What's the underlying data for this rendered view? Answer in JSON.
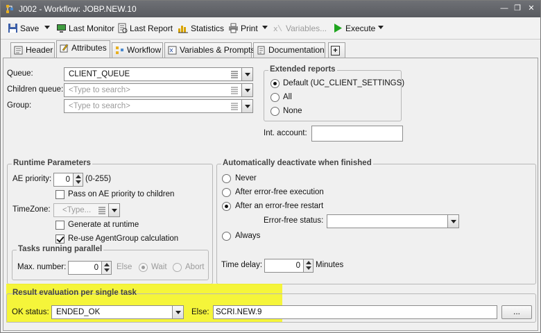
{
  "window": {
    "title": "J002 - Workflow: JOBP.NEW.10",
    "min": "—",
    "max": "❐",
    "close": "✕"
  },
  "toolbar": {
    "save": "Save",
    "last_monitor": "Last Monitor",
    "last_report": "Last Report",
    "statistics": "Statistics",
    "print": "Print",
    "variables": "Variables...",
    "execute": "Execute"
  },
  "tabs": [
    "Header",
    "Attributes",
    "Workflow",
    "Variables & Prompts",
    "Documentation",
    "+"
  ],
  "queue": {
    "queue_label": "Queue:",
    "queue_value": "CLIENT_QUEUE",
    "children_label": "Children queue:",
    "children_placeholder": "<Type to search>",
    "group_label": "Group:",
    "group_placeholder": "<Type to search>"
  },
  "extended_reports": {
    "title": "Extended reports",
    "options": [
      "Default (UC_CLIENT_SETTINGS)",
      "All",
      "None"
    ],
    "selected": 0,
    "int_account_label": "Int. account:",
    "int_account_value": ""
  },
  "runtime": {
    "title": "Runtime Parameters",
    "ae_priority_label": "AE priority:",
    "ae_priority_value": "0",
    "ae_priority_range": "(0-255)",
    "pass_priority": "Pass on AE priority to children",
    "pass_priority_checked": false,
    "timezone_label": "TimeZone:",
    "timezone_placeholder": "<Type...",
    "generate_runtime": "Generate at runtime",
    "generate_runtime_checked": false,
    "reuse_agentgroup": "Re-use AgentGroup calculation",
    "reuse_agentgroup_checked": true
  },
  "parallel": {
    "title": "Tasks running parallel",
    "max_label": "Max. number:",
    "max_value": "0",
    "else_label": "Else",
    "wait": "Wait",
    "abort": "Abort",
    "selected": "Wait"
  },
  "deactivate": {
    "title": "Automatically deactivate when finished",
    "options": [
      "Never",
      "After error-free execution",
      "After an error-free restart",
      "Always"
    ],
    "selected": 2,
    "error_free_status_label": "Error-free status:",
    "error_free_status_value": "",
    "time_delay_label": "Time delay:",
    "time_delay_value": "0",
    "minutes": "Minutes"
  },
  "result": {
    "title": "Result evaluation per single task",
    "ok_status_label": "OK status:",
    "ok_status_value": "ENDED_OK",
    "else_label": "Else:",
    "else_value": "SCRI.NEW.9",
    "browse": "..."
  },
  "colors": {
    "highlight": "#f6f61a",
    "titlebar": "#5f6166"
  }
}
